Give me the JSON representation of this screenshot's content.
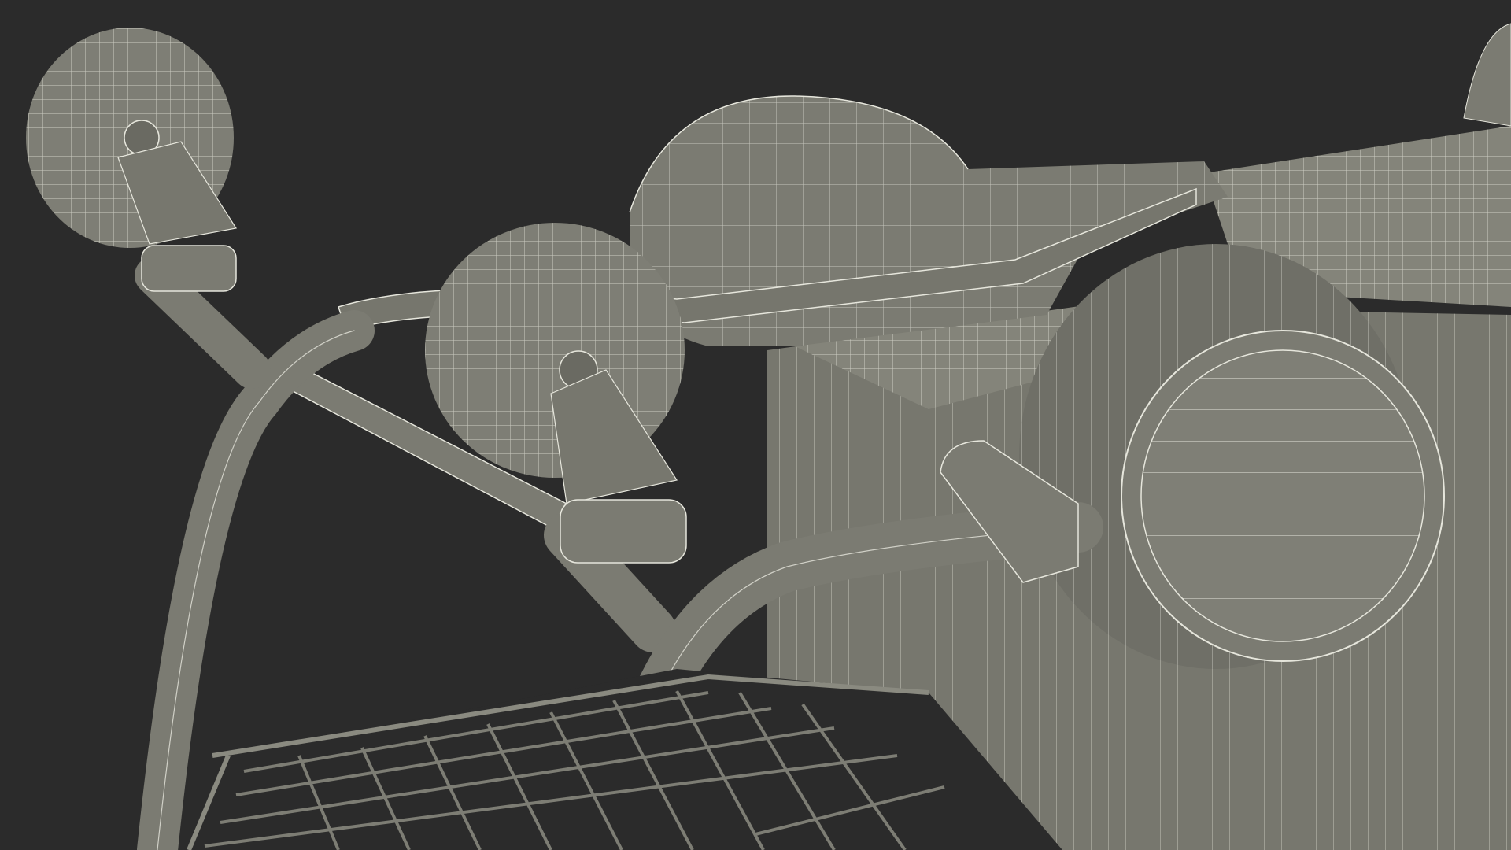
{
  "scene": {
    "background_color": "#2b2b2b",
    "mesh_fill": "#7b7b72",
    "mesh_fill_dark": "#66665e",
    "mesh_fill_light": "#8c8c82",
    "wire_color": "#e6e6dc",
    "objects": [
      "wheel-left",
      "wheel-center",
      "bumper-top",
      "tube-frame",
      "crossbar",
      "control-box",
      "round-plate",
      "handle-arm",
      "wire-basket"
    ]
  }
}
